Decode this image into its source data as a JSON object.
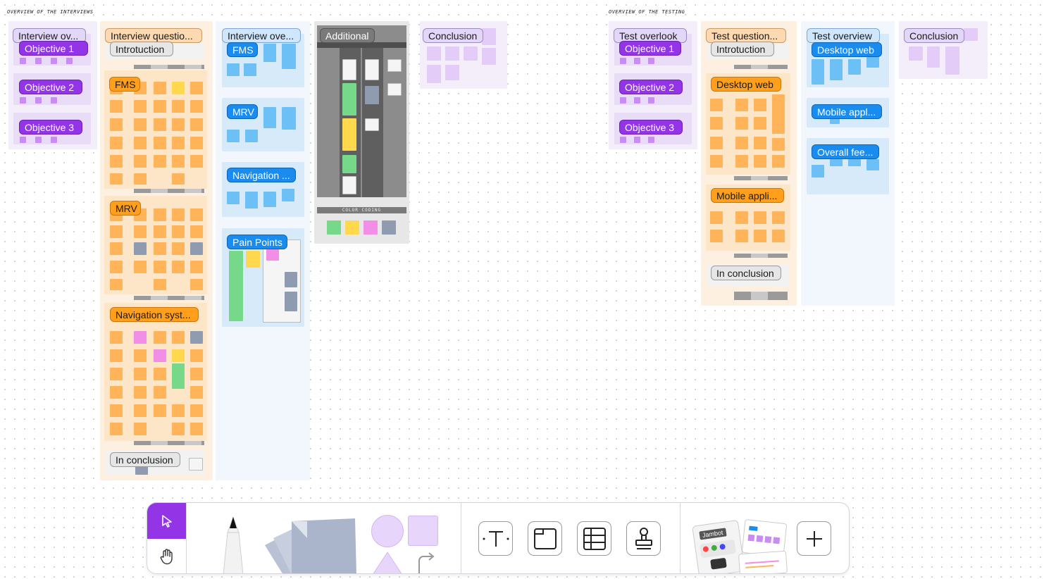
{
  "sections": {
    "interviews_title": "OVERVIEW OF THE INTERVIEWS",
    "testing_title": "OVERVIEW OF THE TESTING"
  },
  "interviews": {
    "col1": {
      "header": "Interview ov...",
      "objectives": [
        "Objective 1",
        "Objective 2",
        "Objective 3"
      ]
    },
    "col2": {
      "header": "Interview questio...",
      "intro": "Introtuction",
      "groups": [
        "FMS",
        "MRV",
        "Navigation syst..."
      ],
      "conclusion": "In conclusion"
    },
    "col3": {
      "header": "Interview ove...",
      "groups": [
        "FMS",
        "MRV",
        "Navigation ...",
        "Pain Points"
      ]
    },
    "col4": {
      "header": "Additional",
      "color_coding": "COLOR CODING"
    },
    "col5": {
      "header": "Conclusion"
    }
  },
  "testing": {
    "col1": {
      "header": "Test overlook",
      "objectives": [
        "Objective 1",
        "Objective 2",
        "Objective 3"
      ]
    },
    "col2": {
      "header": "Test question...",
      "intro": "Introtuction",
      "groups": [
        "Desktop web",
        "Mobile appli..."
      ],
      "conclusion": "In conclusion"
    },
    "col3": {
      "header": "Test overview",
      "groups": [
        "Desktop web",
        "Mobile appl...",
        "Overall fee..."
      ]
    },
    "col4": {
      "header": "Conclusion"
    }
  },
  "toolbar": {
    "tools": [
      "select-tool",
      "hand-tool",
      "pen-tool",
      "sticky-note-tool",
      "shapes-tool",
      "text-tool",
      "section-tool",
      "table-tool",
      "stamp-tool",
      "templates",
      "add-more"
    ],
    "templates_badge": "Jambot"
  },
  "colors": {
    "purple": "#9334e6",
    "orange": "#ff9f1c",
    "blue": "#1a8cf0",
    "accent": "#9334e6"
  }
}
